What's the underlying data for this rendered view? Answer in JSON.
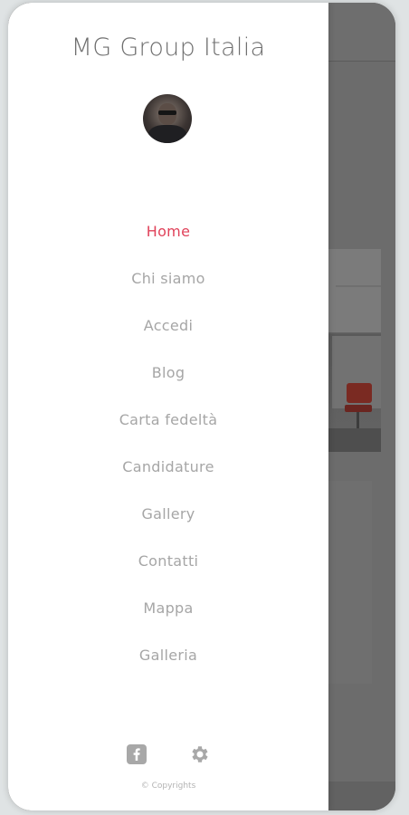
{
  "drawer": {
    "brand": "MG Group Italia",
    "nav": [
      {
        "label": "Home",
        "active": true
      },
      {
        "label": "Chi siamo",
        "active": false
      },
      {
        "label": "Accedi",
        "active": false
      },
      {
        "label": "Blog",
        "active": false
      },
      {
        "label": "Carta fedeltà",
        "active": false
      },
      {
        "label": "Candidature",
        "active": false
      },
      {
        "label": "Gallery",
        "active": false
      },
      {
        "label": "Contatti",
        "active": false
      },
      {
        "label": "Mappa",
        "active": false
      },
      {
        "label": "Galleria",
        "active": false
      }
    ],
    "social_icons": [
      "facebook-icon",
      "gear-icon"
    ],
    "copyright": "© Copyrights"
  },
  "colors": {
    "accent": "#e0425a",
    "nav_text": "#a6a6a6",
    "brand_text": "#6f6f6f",
    "overlay": "#6a6a6a"
  }
}
